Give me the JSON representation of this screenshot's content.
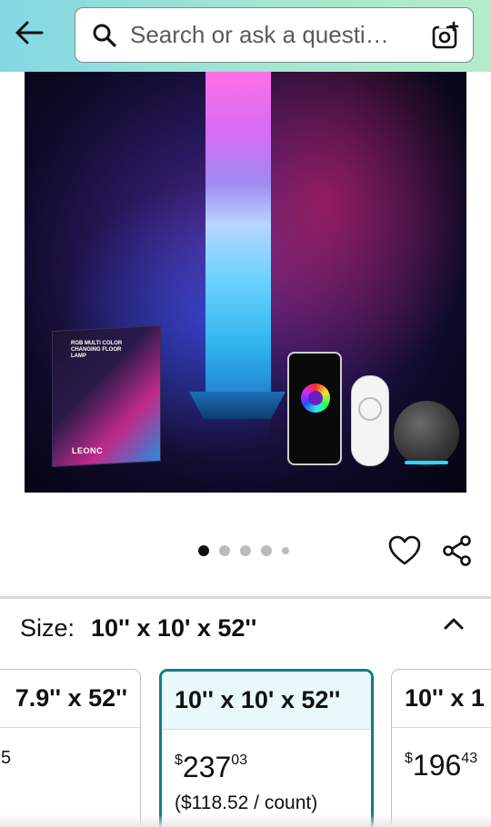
{
  "header": {
    "search_placeholder": "Search or ask a questi…"
  },
  "product_image": {
    "box_title": "RGB MULTI COLOR CHANGING FLOOR LAMP",
    "box_brand": "LEONC"
  },
  "carousel": {
    "total_images": 5,
    "active_index": 0
  },
  "size": {
    "label": "Size:",
    "selected_value": "10'' x 10' x 52''",
    "options": [
      {
        "title": "7.9'' x 52''",
        "price_whole": "",
        "price_fraction": "",
        "unit": "5",
        "selected": false
      },
      {
        "title": "10'' x 10' x 52''",
        "currency": "$",
        "price_whole": "237",
        "price_fraction": "03",
        "unit": "($118.52 / count)",
        "selected": true
      },
      {
        "title": "10'' x 1",
        "currency": "$",
        "price_whole": "196",
        "price_fraction": "43",
        "unit": "",
        "selected": false
      }
    ]
  },
  "colors": {
    "accent": "#127c88",
    "header_start": "#82d8e3",
    "header_end": "#b4ecc9"
  }
}
